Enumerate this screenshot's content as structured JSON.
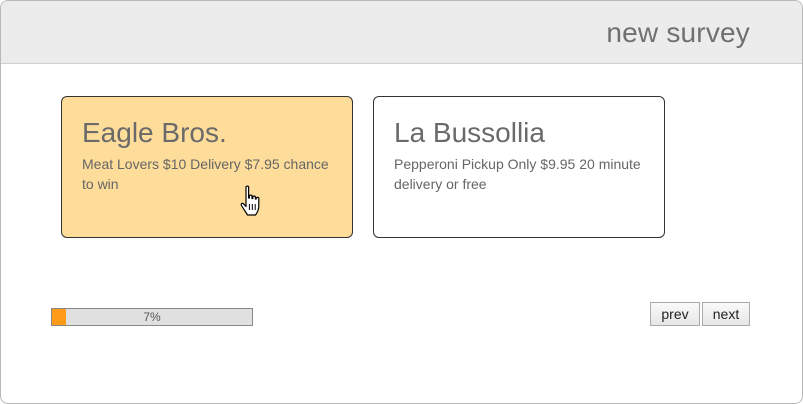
{
  "header": {
    "title": "new survey"
  },
  "options": [
    {
      "name": "Eagle Bros.",
      "description": "Meat Lovers $10 Delivery $7.95 chance to win",
      "selected": true
    },
    {
      "name": "La Bussollia",
      "description": "Pepperoni Pickup Only $9.95 20 minute delivery or free",
      "selected": false
    }
  ],
  "progress": {
    "value": 0.07,
    "label": "7%"
  },
  "nav": {
    "prev_label": "prev",
    "next_label": "next"
  },
  "colors": {
    "header_bg": "#ececec",
    "selected_card_bg": "#fedc9a",
    "progress_fill": "#ff9b16",
    "progress_track": "#e0e0e0"
  },
  "icons": {
    "cursor": "hand-pointer-icon"
  }
}
